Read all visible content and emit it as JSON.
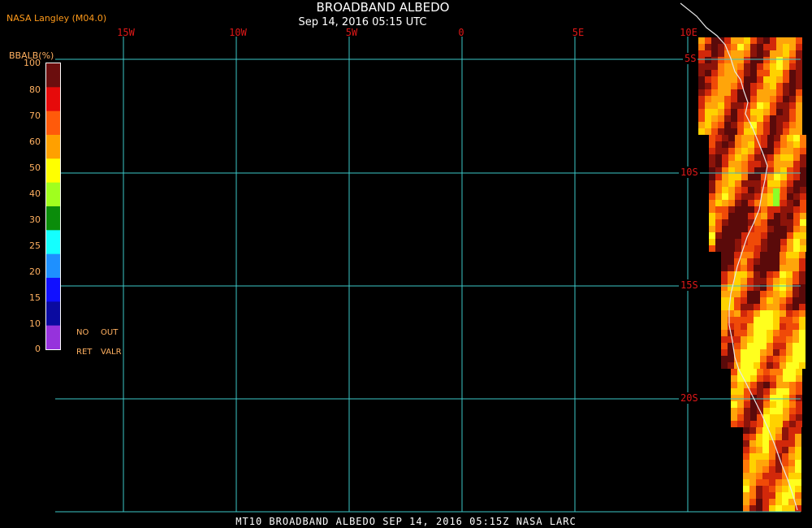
{
  "credit": "NASA Langley (M04.0)",
  "title": "BROADBAND ALBEDO",
  "subtitle": "Sep 14, 2016 05:15 UTC",
  "footer": "MT10  BROADBAND ALBEDO  SEP 14, 2016 05:15Z  NASA LARC",
  "longitude_labels": [
    "15W",
    "10W",
    "5W",
    "0",
    "5E",
    "10E"
  ],
  "latitude_labels": [
    "5S",
    "10S",
    "15S",
    "20S"
  ],
  "colorbar": {
    "title": "BBALB(%)",
    "ticks": [
      "100",
      "80",
      "70",
      "60",
      "50",
      "40",
      "30",
      "25",
      "20",
      "15",
      "10",
      "0"
    ],
    "colors": [
      "#6b0e0e",
      "#e60a0a",
      "#ff5a0a",
      "#ffa000",
      "#ffff00",
      "#a0ff1e",
      "#0a8c0a",
      "#14ffff",
      "#1e90ff",
      "#1010ff",
      "#0a0aa0",
      "#9632dc"
    ],
    "no_ret": [
      "NO",
      "RET"
    ],
    "out_valr": [
      "OUT",
      "VALR"
    ]
  },
  "colors": {
    "grid": "#3cc8c8",
    "labels": "#e01818",
    "coast": "#e8e8e8"
  }
}
